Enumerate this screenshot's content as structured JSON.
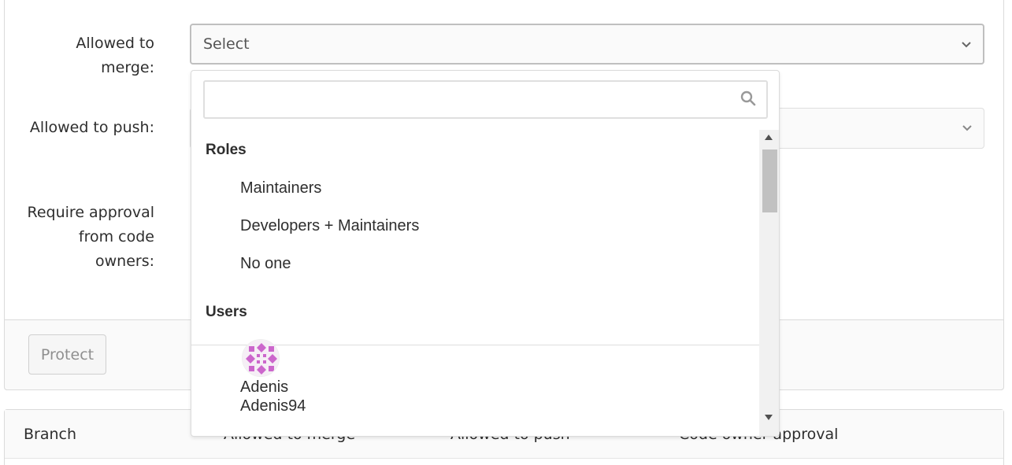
{
  "form": {
    "allowed_to_merge_label": "Allowed to merge:",
    "allowed_to_push_label": "Allowed to push:",
    "code_owner_label": "Require approval from code owners:",
    "merge_select_placeholder": "Select",
    "protect_button": "Protect"
  },
  "dropdown": {
    "search_value": "",
    "roles_header": "Roles",
    "roles": [
      "Maintainers",
      "Developers + Maintainers",
      "No one"
    ],
    "users_header": "Users",
    "users": [
      {
        "name": "Adenis",
        "username": "Adenis94"
      }
    ]
  },
  "table": {
    "headers": [
      "Branch",
      "Allowed to merge",
      "Allowed to push",
      "Code owner approval"
    ]
  },
  "colors": {
    "avatar_primary": "#cc66cc",
    "badge_bg": "#fbe5e1"
  }
}
